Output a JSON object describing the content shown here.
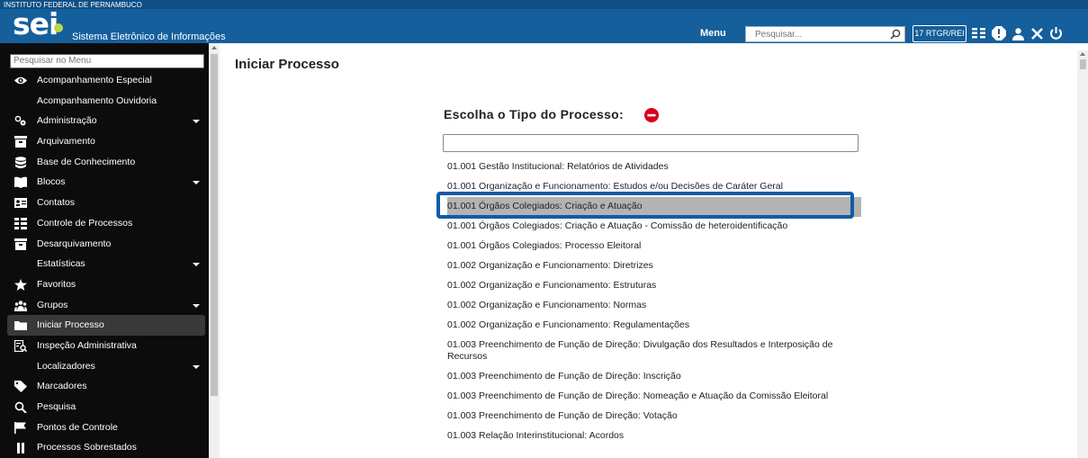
{
  "header": {
    "institution": "INSTITUTO FEDERAL DE PERNAMBUCO",
    "logo": "sei",
    "system_name": "Sistema Eletrônico de Informações",
    "menu_label": "Menu",
    "search_placeholder": "Pesquisar...",
    "unit": "17 RTGR/REI",
    "icons": [
      "list-icon",
      "warning-icon",
      "user-icon",
      "tools-icon",
      "power-icon"
    ],
    "colors": {
      "bar": "#155f9c",
      "logo_dot": "#bcd64a"
    }
  },
  "sidebar": {
    "search_placeholder": "Pesquisar no Menu",
    "items": [
      {
        "label": "Acompanhamento Especial",
        "icon": "eye-icon",
        "has_submenu": false
      },
      {
        "label": "Acompanhamento Ouvidoria",
        "icon": "",
        "has_submenu": false
      },
      {
        "label": "Administração",
        "icon": "gears-icon",
        "has_submenu": true
      },
      {
        "label": "Arquivamento",
        "icon": "archive-icon",
        "has_submenu": false
      },
      {
        "label": "Base de Conhecimento",
        "icon": "database-icon",
        "has_submenu": false
      },
      {
        "label": "Blocos",
        "icon": "book-icon",
        "has_submenu": true
      },
      {
        "label": "Contatos",
        "icon": "contact-card-icon",
        "has_submenu": false
      },
      {
        "label": "Controle de Processos",
        "icon": "list-icon",
        "has_submenu": false
      },
      {
        "label": "Desarquivamento",
        "icon": "archive-icon",
        "has_submenu": false
      },
      {
        "label": "Estatísticas",
        "icon": "",
        "has_submenu": true
      },
      {
        "label": "Favoritos",
        "icon": "star-icon",
        "has_submenu": false
      },
      {
        "label": "Grupos",
        "icon": "group-icon",
        "has_submenu": true
      },
      {
        "label": "Iniciar Processo",
        "icon": "folder-icon",
        "has_submenu": false,
        "active": true
      },
      {
        "label": "Inspeção Administrativa",
        "icon": "inspection-icon",
        "has_submenu": false
      },
      {
        "label": "Localizadores",
        "icon": "",
        "has_submenu": true
      },
      {
        "label": "Marcadores",
        "icon": "tag-icon",
        "has_submenu": false
      },
      {
        "label": "Pesquisa",
        "icon": "search-icon",
        "has_submenu": false
      },
      {
        "label": "Pontos de Controle",
        "icon": "flag-icon",
        "has_submenu": false
      },
      {
        "label": "Processos Sobrestados",
        "icon": "pause-icon",
        "has_submenu": false
      }
    ]
  },
  "main": {
    "title": "Iniciar Processo",
    "choose_label": "Escolha o Tipo do Processo:",
    "filter_value": "",
    "types": [
      "01.001 Gestão Institucional: Relatórios de Atividades",
      "01.001 Organização e Funcionamento: Estudos e/ou Decisões de Caráter Geral",
      "01.001 Órgãos Colegiados: Criação e Atuação",
      "01.001 Órgãos Colegiados: Criação e Atuação - Comissão de heteroidentificação",
      "01.001 Órgãos Colegiados: Processo Eleitoral",
      "01.002 Organização e Funcionamento: Diretrizes",
      "01.002 Organização e Funcionamento: Estruturas",
      "01.002 Organização e Funcionamento: Normas",
      "01.002 Organização e Funcionamento: Regulamentações",
      "01.003 Preenchimento de Função de Direção: Divulgação dos Resultados e Interposição de Recursos",
      "01.003 Preenchimento de Função de Direção: Inscrição",
      "01.003 Preenchimento de Função de Direção: Nomeação e Atuação da Comissão Eleitoral",
      "01.003 Preenchimento de Função de Direção: Votação",
      "01.003 Relação Interinstitucional: Acordos"
    ],
    "selected_index": 2,
    "colors": {
      "highlight_box": "#0e5ca8",
      "selected_row": "#b3b3b3",
      "minus_icon": "#d9001b"
    }
  }
}
